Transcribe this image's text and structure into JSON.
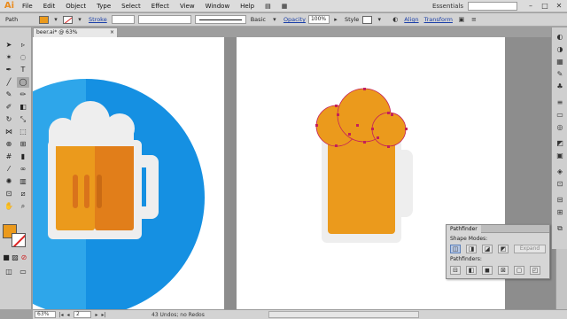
{
  "app": {
    "logo": "Ai",
    "workspace": "Essentials"
  },
  "menu": [
    "File",
    "Edit",
    "Object",
    "Type",
    "Select",
    "Effect",
    "View",
    "Window",
    "Help"
  ],
  "control_bar": {
    "selection": "Path",
    "stroke_label": "Stroke",
    "brush_label": "Basic",
    "opacity_label": "Opacity",
    "opacity_value": "100%",
    "style_label": "Style",
    "align_label": "Align",
    "transform_label": "Transform"
  },
  "document": {
    "tab_title": "beer.ai* @ 63% (RGB/Preview)",
    "close": "×"
  },
  "pathfinder": {
    "tab": "Pathfinder",
    "shape_modes_label": "Shape Modes:",
    "expand_label": "Expand",
    "pathfinders_label": "Pathfinders:"
  },
  "status": {
    "zoom": "63%",
    "artboard": "2",
    "undos": "43 Undos; no Redos"
  },
  "colors": {
    "fill": "#eb9a1c",
    "circle_light": "#2ea6ea",
    "circle_dark": "#1590e2",
    "foam": "#eeeeee",
    "beer_light": "#eb9a1c",
    "beer_dark": "#e17e1a",
    "selection_stroke": "#c4205a"
  },
  "icons": {
    "minimize": "minimize-icon",
    "maximize": "maximize-icon",
    "close": "close-icon"
  }
}
